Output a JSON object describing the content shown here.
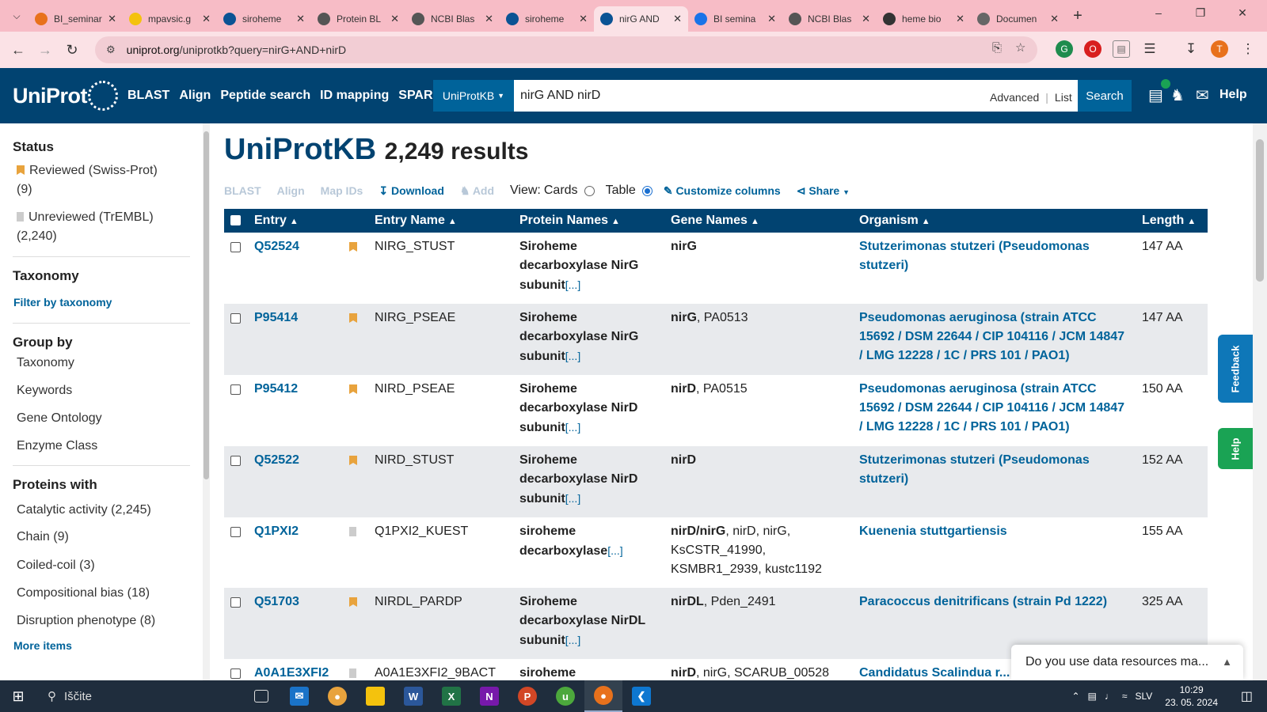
{
  "browser": {
    "tabs": [
      {
        "title": "BI_seminar",
        "color": "#e8711c",
        "active": false
      },
      {
        "title": "mpavsic.g",
        "color": "#f4c20d",
        "active": false
      },
      {
        "title": "siroheme",
        "color": "#0b5394",
        "active": false
      },
      {
        "title": "Protein BL",
        "color": "#555555",
        "active": false
      },
      {
        "title": "NCBI Blas",
        "color": "#555555",
        "active": false
      },
      {
        "title": "siroheme",
        "color": "#0b5394",
        "active": false
      },
      {
        "title": "nirG AND",
        "color": "#0b5394",
        "active": true
      },
      {
        "title": "BI semina",
        "color": "#1a73e8",
        "active": false
      },
      {
        "title": "NCBI Blas",
        "color": "#555555",
        "active": false
      },
      {
        "title": "heme bio",
        "color": "#333333",
        "active": false
      },
      {
        "title": "Documen",
        "color": "#666666",
        "active": false
      }
    ],
    "url_host": "uniprot.org",
    "url_path": "/uniprotkb?query=nirG+AND+nirD"
  },
  "header": {
    "logo": "UniProt",
    "nav": [
      "BLAST",
      "Align",
      "Peptide search",
      "ID mapping",
      "SPARQL"
    ],
    "db_select": "UniProtKB",
    "query": "nirG AND nirD",
    "advanced": "Advanced",
    "list": "List",
    "search_btn": "Search",
    "help": "Help"
  },
  "sidebar": {
    "status_title": "Status",
    "reviewed": "Reviewed (Swiss-Prot)",
    "reviewed_count": "(9)",
    "unreviewed": "Unreviewed (TrEMBL)",
    "unreviewed_count": "(2,240)",
    "taxonomy_title": "Taxonomy",
    "filter_taxonomy": "Filter by taxonomy",
    "groupby_title": "Group by",
    "groupby": [
      "Taxonomy",
      "Keywords",
      "Gene Ontology",
      "Enzyme Class"
    ],
    "proteins_title": "Proteins with",
    "proteins": [
      "Catalytic activity (2,245)",
      "Chain (9)",
      "Coiled-coil (3)",
      "Compositional bias (18)",
      "Disruption phenotype (8)"
    ],
    "more_items": "More items"
  },
  "main": {
    "title": "UniProtKB",
    "count": "2,249 results",
    "toolbar": {
      "blast": "BLAST",
      "align": "Align",
      "mapids": "Map IDs",
      "download": "Download",
      "add": "Add",
      "view": "View:",
      "cards": "Cards",
      "table": "Table",
      "customize": "Customize columns",
      "share": "Share"
    },
    "columns": [
      "Entry",
      "Entry Name",
      "Protein Names",
      "Gene Names",
      "Organism",
      "Length"
    ],
    "rows": [
      {
        "entry": "Q52524",
        "reviewed": true,
        "name": "NIRG_STUST",
        "protein1": "Siroheme",
        "protein2": "decarboxylase NirG",
        "protein3": "subunit",
        "gene_bold": "nirG",
        "gene_rest": "",
        "organism": "Stutzerimonas stutzeri (Pseudomonas stutzeri)",
        "length": "147 AA"
      },
      {
        "entry": "P95414",
        "reviewed": true,
        "name": "NIRG_PSEAE",
        "protein1": "Siroheme",
        "protein2": "decarboxylase NirG",
        "protein3": "subunit",
        "gene_bold": "nirG",
        "gene_rest": ", PA0513",
        "organism": "Pseudomonas aeruginosa (strain ATCC 15692 / DSM 22644 / CIP 104116 / JCM 14847 / LMG 12228 / 1C / PRS 101 / PAO1)",
        "length": "147 AA"
      },
      {
        "entry": "P95412",
        "reviewed": true,
        "name": "NIRD_PSEAE",
        "protein1": "Siroheme",
        "protein2": "decarboxylase NirD",
        "protein3": "subunit",
        "gene_bold": "nirD",
        "gene_rest": ", PA0515",
        "organism": "Pseudomonas aeruginosa (strain ATCC 15692 / DSM 22644 / CIP 104116 / JCM 14847 / LMG 12228 / 1C / PRS 101 / PAO1)",
        "length": "150 AA"
      },
      {
        "entry": "Q52522",
        "reviewed": true,
        "name": "NIRD_STUST",
        "protein1": "Siroheme",
        "protein2": "decarboxylase NirD",
        "protein3": "subunit",
        "gene_bold": "nirD",
        "gene_rest": "",
        "organism": "Stutzerimonas stutzeri (Pseudomonas stutzeri)",
        "length": "152 AA"
      },
      {
        "entry": "Q1PXI2",
        "reviewed": false,
        "name": "Q1PXI2_KUEST",
        "protein1": "siroheme",
        "protein2": "decarboxylase",
        "protein3": "",
        "gene_bold": "nirD/nirG",
        "gene_rest": ", nirD, nirG, KsCSTR_41990, KSMBR1_2939, kustc1192",
        "organism": "Kuenenia stuttgartiensis",
        "length": "155 AA"
      },
      {
        "entry": "Q51703",
        "reviewed": true,
        "name": "NIRDL_PARDP",
        "protein1": "Siroheme",
        "protein2": "decarboxylase NirDL",
        "protein3": "subunit",
        "gene_bold": "nirDL",
        "gene_rest": ", Pden_2491",
        "organism": "Paracoccus denitrificans (strain Pd 1222)",
        "length": "325 AA"
      },
      {
        "entry": "A0A1E3XFI2",
        "reviewed": false,
        "name": "A0A1E3XFI2_9BACT",
        "protein1": "siroheme",
        "protein2": "",
        "protein3": "",
        "gene_bold": "nirD",
        "gene_rest": ", nirG, SCARUB_00528",
        "organism": "Candidatus Scalindua r...",
        "length": ""
      }
    ],
    "more_label": "[...]"
  },
  "side_tabs": {
    "feedback": "Feedback",
    "help": "Help"
  },
  "survey": "Do you use data resources ma...",
  "taskbar": {
    "search": "Iščite",
    "lang": "SLV",
    "time": "10:29",
    "date": "23. 05. 2024"
  }
}
